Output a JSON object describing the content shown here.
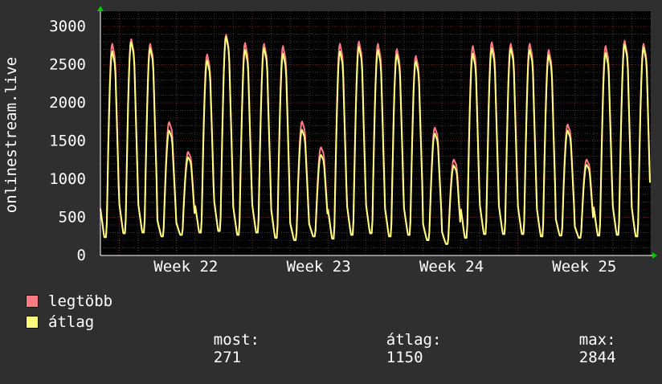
{
  "chart_data": {
    "type": "line",
    "ylabel": "onlinestream.live",
    "ylim": [
      0,
      3200
    ],
    "yticks": [
      0,
      500,
      1000,
      1500,
      2000,
      2500,
      3000
    ],
    "x_tick_labels": [
      "Week 22",
      "Week 23",
      "Week 24",
      "Week 25"
    ],
    "grid": true,
    "series": [
      {
        "name": "legtöbb",
        "color": "#ff7b84",
        "daily_peaks": [
          2780,
          2840,
          2780,
          1750,
          1360,
          2640,
          2900,
          2790,
          2780,
          2750,
          1760,
          1420,
          2780,
          2810,
          2780,
          2710,
          2620,
          1680,
          1260,
          2750,
          2800,
          2780,
          2780,
          2700,
          1720,
          1260,
          2750,
          2820,
          2780
        ]
      },
      {
        "name": "átlag",
        "color": "#ffff80",
        "daily_peaks": [
          2680,
          2800,
          2720,
          1640,
          1290,
          2560,
          2870,
          2700,
          2720,
          2650,
          1650,
          1320,
          2680,
          2740,
          2700,
          2640,
          2550,
          1600,
          1180,
          2650,
          2720,
          2720,
          2700,
          2630,
          1640,
          1190,
          2660,
          2770,
          2730
        ]
      }
    ],
    "daily_lows": [
      240,
      290,
      300,
      250,
      270,
      300,
      320,
      270,
      300,
      230,
      200,
      250,
      220,
      270,
      290,
      250,
      270,
      200,
      150,
      230,
      280,
      280,
      280,
      250,
      260,
      230,
      260,
      270,
      250
    ]
  },
  "legend": {
    "max_label": "legtöbb",
    "avg_label": "átlag",
    "max_color": "#ff7b84",
    "avg_color": "#ffff80",
    "stats": {
      "current_label": "most:",
      "current_value": "271",
      "avg_label": "átlag:",
      "avg_value": "1150",
      "max_label": "max:",
      "max_value": "2844"
    }
  }
}
